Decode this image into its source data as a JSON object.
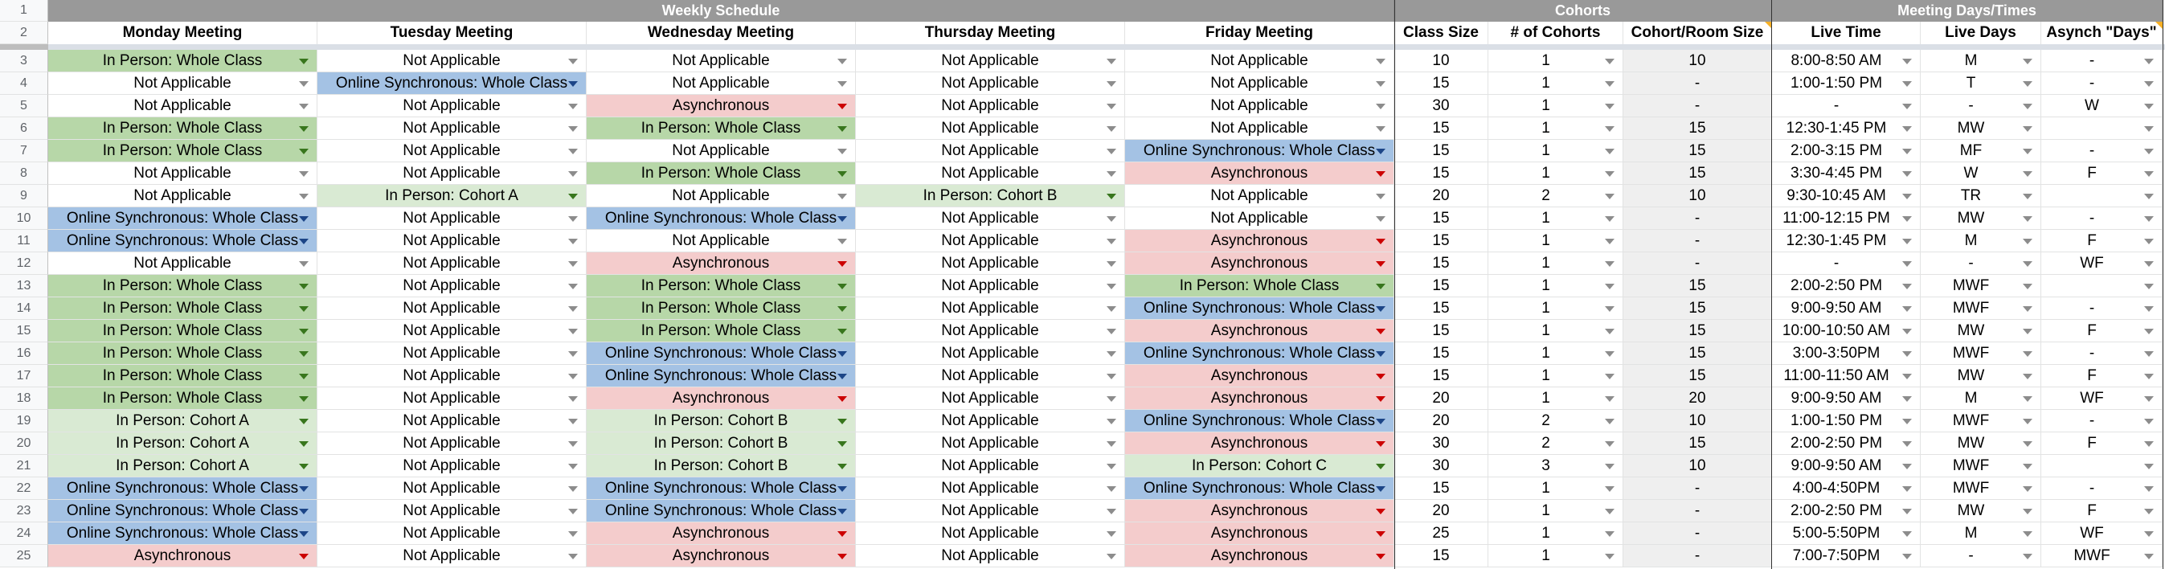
{
  "app": "Spreadsheet",
  "row_numbers": [
    "1",
    "2",
    "3",
    "4",
    "5",
    "6",
    "7",
    "8",
    "9",
    "10",
    "11",
    "12",
    "13",
    "14",
    "15",
    "16",
    "17",
    "18",
    "19",
    "20",
    "21",
    "22",
    "23",
    "24",
    "25"
  ],
  "group_headers": {
    "weekly": "Weekly Schedule",
    "cohorts": "Cohorts",
    "meeting": "Meeting Days/Times"
  },
  "columns": [
    "Monday Meeting",
    "Tuesday Meeting",
    "Wednesday Meeting",
    "Thursday Meeting",
    "Friday Meeting",
    "Class Size",
    "# of Cohorts",
    "Cohort/Room Size",
    "Live Time",
    "Live Days",
    "Asynch \"Days\""
  ],
  "colors": {
    "in_person_whole": "#b7d7a8",
    "in_person_cohort": "#d9ead3",
    "online_sync": "#a4c2e4",
    "asynchronous": "#f4cccc",
    "not_applicable": "#ffffff",
    "group_header_bg": "#999999"
  },
  "options": {
    "IPW": "In Person: Whole Class",
    "IPCA": "In Person: Cohort A",
    "IPCB": "In Person: Cohort B",
    "IPCC": "In Person: Cohort C",
    "OSW": "Online Synchronous: Whole Class",
    "ASYNC": "Asynchronous",
    "NA": "Not Applicable"
  },
  "rows": [
    {
      "days": [
        "In Person: Whole Class",
        "Not Applicable",
        "Not Applicable",
        "Not Applicable",
        "Not Applicable"
      ],
      "class_size": "10",
      "cohorts": "1",
      "room_size": "10",
      "live_time": "8:00-8:50 AM",
      "live_days": "M",
      "async_days": "-"
    },
    {
      "days": [
        "Not Applicable",
        "Online Synchronous: Whole Class",
        "Not Applicable",
        "Not Applicable",
        "Not Applicable"
      ],
      "class_size": "15",
      "cohorts": "1",
      "room_size": "-",
      "live_time": "1:00-1:50 PM",
      "live_days": "T",
      "async_days": "-"
    },
    {
      "days": [
        "Not Applicable",
        "Not Applicable",
        "Asynchronous",
        "Not Applicable",
        "Not Applicable"
      ],
      "class_size": "30",
      "cohorts": "1",
      "room_size": "-",
      "live_time": "-",
      "live_days": "-",
      "async_days": "W"
    },
    {
      "days": [
        "In Person: Whole Class",
        "Not Applicable",
        "In Person: Whole Class",
        "Not Applicable",
        "Not Applicable"
      ],
      "class_size": "15",
      "cohorts": "1",
      "room_size": "15",
      "live_time": "12:30-1:45 PM",
      "live_days": "MW",
      "async_days": ""
    },
    {
      "days": [
        "In Person: Whole Class",
        "Not Applicable",
        "Not Applicable",
        "Not Applicable",
        "Online Synchronous: Whole Class"
      ],
      "class_size": "15",
      "cohorts": "1",
      "room_size": "15",
      "live_time": "2:00-3:15 PM",
      "live_days": "MF",
      "async_days": "-"
    },
    {
      "days": [
        "Not Applicable",
        "Not Applicable",
        "In Person: Whole Class",
        "Not Applicable",
        "Asynchronous"
      ],
      "class_size": "15",
      "cohorts": "1",
      "room_size": "15",
      "live_time": "3:30-4:45 PM",
      "live_days": "W",
      "async_days": "F"
    },
    {
      "days": [
        "Not Applicable",
        "In Person: Cohort A",
        "Not Applicable",
        "In Person: Cohort B",
        "Not Applicable"
      ],
      "class_size": "20",
      "cohorts": "2",
      "room_size": "10",
      "live_time": "9:30-10:45 AM",
      "live_days": "TR",
      "async_days": ""
    },
    {
      "days": [
        "Online Synchronous: Whole Class",
        "Not Applicable",
        "Online Synchronous: Whole Class",
        "Not Applicable",
        "Not Applicable"
      ],
      "class_size": "15",
      "cohorts": "1",
      "room_size": "-",
      "live_time": "11:00-12:15 PM",
      "live_days": "MW",
      "async_days": "-"
    },
    {
      "days": [
        "Online Synchronous: Whole Class",
        "Not Applicable",
        "Not Applicable",
        "Not Applicable",
        "Asynchronous"
      ],
      "class_size": "15",
      "cohorts": "1",
      "room_size": "-",
      "live_time": "12:30-1:45 PM",
      "live_days": "M",
      "async_days": "F"
    },
    {
      "days": [
        "Not Applicable",
        "Not Applicable",
        "Asynchronous",
        "Not Applicable",
        "Asynchronous"
      ],
      "class_size": "15",
      "cohorts": "1",
      "room_size": "-",
      "live_time": "-",
      "live_days": "-",
      "async_days": "WF"
    },
    {
      "days": [
        "In Person: Whole Class",
        "Not Applicable",
        "In Person: Whole Class",
        "Not Applicable",
        "In Person: Whole Class"
      ],
      "class_size": "15",
      "cohorts": "1",
      "room_size": "15",
      "live_time": "2:00-2:50 PM",
      "live_days": "MWF",
      "async_days": ""
    },
    {
      "days": [
        "In Person: Whole Class",
        "Not Applicable",
        "In Person: Whole Class",
        "Not Applicable",
        "Online Synchronous: Whole Class"
      ],
      "class_size": "15",
      "cohorts": "1",
      "room_size": "15",
      "live_time": "9:00-9:50 AM",
      "live_days": "MWF",
      "async_days": "-"
    },
    {
      "days": [
        "In Person: Whole Class",
        "Not Applicable",
        "In Person: Whole Class",
        "Not Applicable",
        "Asynchronous"
      ],
      "class_size": "15",
      "cohorts": "1",
      "room_size": "15",
      "live_time": "10:00-10:50 AM",
      "live_days": "MW",
      "async_days": "F"
    },
    {
      "days": [
        "In Person: Whole Class",
        "Not Applicable",
        "Online Synchronous: Whole Class",
        "Not Applicable",
        "Online Synchronous: Whole Class"
      ],
      "class_size": "15",
      "cohorts": "1",
      "room_size": "15",
      "live_time": "3:00-3:50PM",
      "live_days": "MWF",
      "async_days": "-"
    },
    {
      "days": [
        "In Person: Whole Class",
        "Not Applicable",
        "Online Synchronous: Whole Class",
        "Not Applicable",
        "Asynchronous"
      ],
      "class_size": "15",
      "cohorts": "1",
      "room_size": "15",
      "live_time": "11:00-11:50 AM",
      "live_days": "MW",
      "async_days": "F"
    },
    {
      "days": [
        "In Person: Whole Class",
        "Not Applicable",
        "Asynchronous",
        "Not Applicable",
        "Asynchronous"
      ],
      "class_size": "20",
      "cohorts": "1",
      "room_size": "20",
      "live_time": "9:00-9:50 AM",
      "live_days": "M",
      "async_days": "WF"
    },
    {
      "days": [
        "In Person: Cohort A",
        "Not Applicable",
        "In Person: Cohort B",
        "Not Applicable",
        "Online Synchronous: Whole Class"
      ],
      "class_size": "20",
      "cohorts": "2",
      "room_size": "10",
      "live_time": "1:00-1:50 PM",
      "live_days": "MWF",
      "async_days": "-"
    },
    {
      "days": [
        "In Person: Cohort A",
        "Not Applicable",
        "In Person: Cohort B",
        "Not Applicable",
        "Asynchronous"
      ],
      "class_size": "30",
      "cohorts": "2",
      "room_size": "15",
      "live_time": "2:00-2:50 PM",
      "live_days": "MW",
      "async_days": "F"
    },
    {
      "days": [
        "In Person: Cohort A",
        "Not Applicable",
        "In Person: Cohort B",
        "Not Applicable",
        "In Person: Cohort C"
      ],
      "class_size": "30",
      "cohorts": "3",
      "room_size": "10",
      "live_time": "9:00-9:50 AM",
      "live_days": "MWF",
      "async_days": ""
    },
    {
      "days": [
        "Online Synchronous: Whole Class",
        "Not Applicable",
        "Online Synchronous: Whole Class",
        "Not Applicable",
        "Online Synchronous: Whole Class"
      ],
      "class_size": "15",
      "cohorts": "1",
      "room_size": "-",
      "live_time": "4:00-4:50PM",
      "live_days": "MWF",
      "async_days": "-"
    },
    {
      "days": [
        "Online Synchronous: Whole Class",
        "Not Applicable",
        "Online Synchronous: Whole Class",
        "Not Applicable",
        "Asynchronous"
      ],
      "class_size": "20",
      "cohorts": "1",
      "room_size": "-",
      "live_time": "2:00-2:50 PM",
      "live_days": "MW",
      "async_days": "F"
    },
    {
      "days": [
        "Online Synchronous: Whole Class",
        "Not Applicable",
        "Asynchronous",
        "Not Applicable",
        "Asynchronous"
      ],
      "class_size": "25",
      "cohorts": "1",
      "room_size": "-",
      "live_time": "5:00-5:50PM",
      "live_days": "M",
      "async_days": "WF"
    },
    {
      "days": [
        "Asynchronous",
        "Not Applicable",
        "Asynchronous",
        "Not Applicable",
        "Asynchronous"
      ],
      "class_size": "15",
      "cohorts": "1",
      "room_size": "-",
      "live_time": "7:00-7:50PM",
      "live_days": "-",
      "async_days": "MWF"
    }
  ]
}
